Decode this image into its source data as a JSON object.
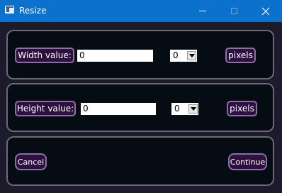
{
  "window": {
    "title": "Resize"
  },
  "width_row": {
    "label": "Width value:",
    "value": "0",
    "unit_select": "0",
    "unit_label": "pixels"
  },
  "height_row": {
    "label": "Height value:",
    "value": "0",
    "unit_select": "0",
    "unit_label": "pixels"
  },
  "actions": {
    "cancel": "Cancel",
    "continue": "Continue"
  },
  "colors": {
    "titlebar": "#0a72cc",
    "panel_bg": "#050d12",
    "panel_border": "#6a6a78",
    "button_bg": "#2d1040",
    "button_border": "#8c6fa3"
  }
}
